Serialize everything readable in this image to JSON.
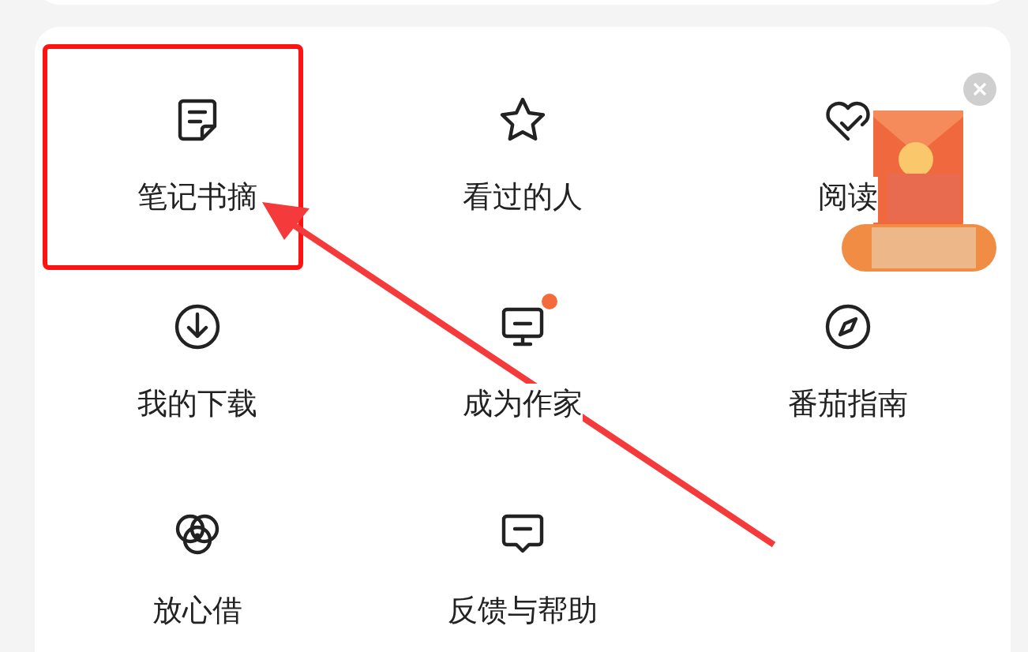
{
  "menu": {
    "items": [
      {
        "label": "笔记书摘",
        "badge": false,
        "highlighted": true
      },
      {
        "label": "看过的人",
        "badge": false,
        "highlighted": false
      },
      {
        "label": "阅读",
        "badge": false,
        "highlighted": false
      },
      {
        "label": "我的下载",
        "badge": false,
        "highlighted": false
      },
      {
        "label": "成为作家",
        "badge": true,
        "highlighted": false
      },
      {
        "label": "番茄指南",
        "badge": false,
        "highlighted": false
      },
      {
        "label": "放心借",
        "badge": false,
        "highlighted": false
      },
      {
        "label": "反馈与帮助",
        "badge": false,
        "highlighted": false
      }
    ]
  }
}
